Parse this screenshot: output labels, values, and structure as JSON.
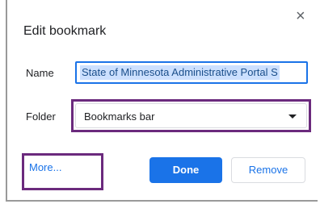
{
  "dialog": {
    "title": "Edit bookmark",
    "close_glyph": "×",
    "name_label": "Name",
    "name_value": "State of Minnesota Administrative Portal S",
    "folder_label": "Folder",
    "folder_value": "Bookmarks bar",
    "more_label": "More...",
    "done_label": "Done",
    "remove_label": "Remove"
  },
  "colors": {
    "accent": "#1a73e8",
    "highlight_box": "#6b2a7d",
    "selection": "#cce0ff"
  }
}
